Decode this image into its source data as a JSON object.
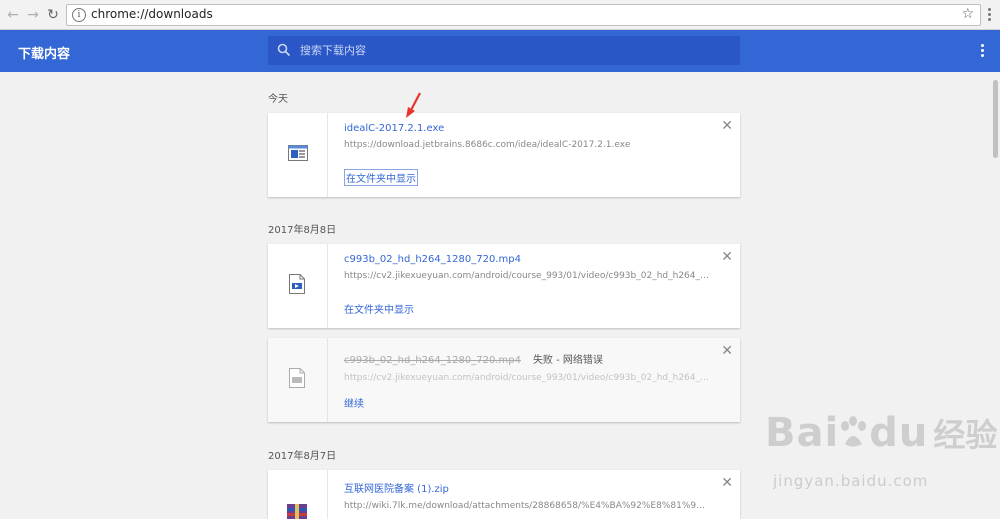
{
  "browser": {
    "url": "chrome://downloads"
  },
  "header": {
    "title": "下载内容",
    "search_placeholder": "搜索下载内容"
  },
  "groups": [
    {
      "date": "今天",
      "items": [
        {
          "name": "idealC-2017.2.1.exe",
          "url": "https://download.jetbrains.8686c.com/idea/idealC-2017.2.1.exe",
          "action": "在文件夹中显示"
        }
      ]
    },
    {
      "date": "2017年8月8日",
      "items": [
        {
          "name": "c993b_02_hd_h264_1280_720.mp4",
          "url": "https://cv2.jikexueyuan.com/android/course_993/01/video/c993b_02_hd_h264_12...",
          "action": "在文件夹中显示"
        },
        {
          "name": "c993b_02_hd_h264_1280_720.mp4",
          "status": "失败 - 网络错误",
          "url": "https://cv2.jikexueyuan.com/android/course_993/01/video/c993b_02_hd_h264_12...",
          "action": "继续"
        }
      ]
    },
    {
      "date": "2017年8月7日",
      "items": [
        {
          "name": "互联网医院备案 (1).zip",
          "url": "http://wiki.7lk.me/download/attachments/28868658/%E4%BA%92%E8%81%94%E7..."
        }
      ]
    }
  ],
  "colors": {
    "header_blue": "#3367d6",
    "link_blue": "#3367d6",
    "annotation_red": "#e8342c"
  },
  "watermark": {
    "brand": "Bai",
    "brand_tail": "du",
    "cn": "经验",
    "url": "jingyan.baidu.com"
  }
}
